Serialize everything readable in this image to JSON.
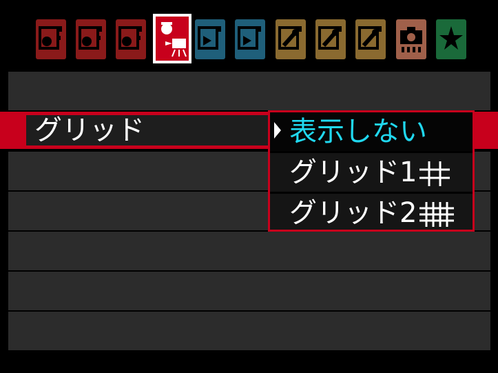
{
  "tabs": [
    {
      "name": "shooting-tab-1",
      "icon": "camera-page-icon",
      "color": "#8a1a1a",
      "selected": false
    },
    {
      "name": "shooting-tab-2",
      "icon": "camera-page-icon",
      "color": "#8a1a1a",
      "selected": false
    },
    {
      "name": "shooting-tab-3",
      "icon": "camera-page-icon",
      "color": "#8a1a1a",
      "selected": false
    },
    {
      "name": "live-view-movie-tab",
      "icon": "camera-movie-icon",
      "color": "#c8001c",
      "selected": true
    },
    {
      "name": "playback-tab-1",
      "icon": "playback-page-icon",
      "color": "#1f5f7a",
      "selected": false
    },
    {
      "name": "playback-tab-2",
      "icon": "playback-page-icon",
      "color": "#1f5f7a",
      "selected": false
    },
    {
      "name": "setup-tab-1",
      "icon": "wrench-page-icon",
      "color": "#8a6a30",
      "selected": false
    },
    {
      "name": "setup-tab-2",
      "icon": "wrench-page-icon",
      "color": "#8a6a30",
      "selected": false
    },
    {
      "name": "setup-tab-3",
      "icon": "wrench-page-icon",
      "color": "#8a6a30",
      "selected": false
    },
    {
      "name": "custom-functions-tab",
      "icon": "camera-function-icon",
      "color": "#a0604a",
      "selected": false
    },
    {
      "name": "my-menu-tab",
      "icon": "star-icon",
      "color": "#1a6a3a",
      "selected": false
    }
  ],
  "menu": {
    "selected_item": "グリッド"
  },
  "dropdown": {
    "options": [
      "表示しない",
      "グリッド1",
      "グリッド2"
    ],
    "current_index": 0
  }
}
